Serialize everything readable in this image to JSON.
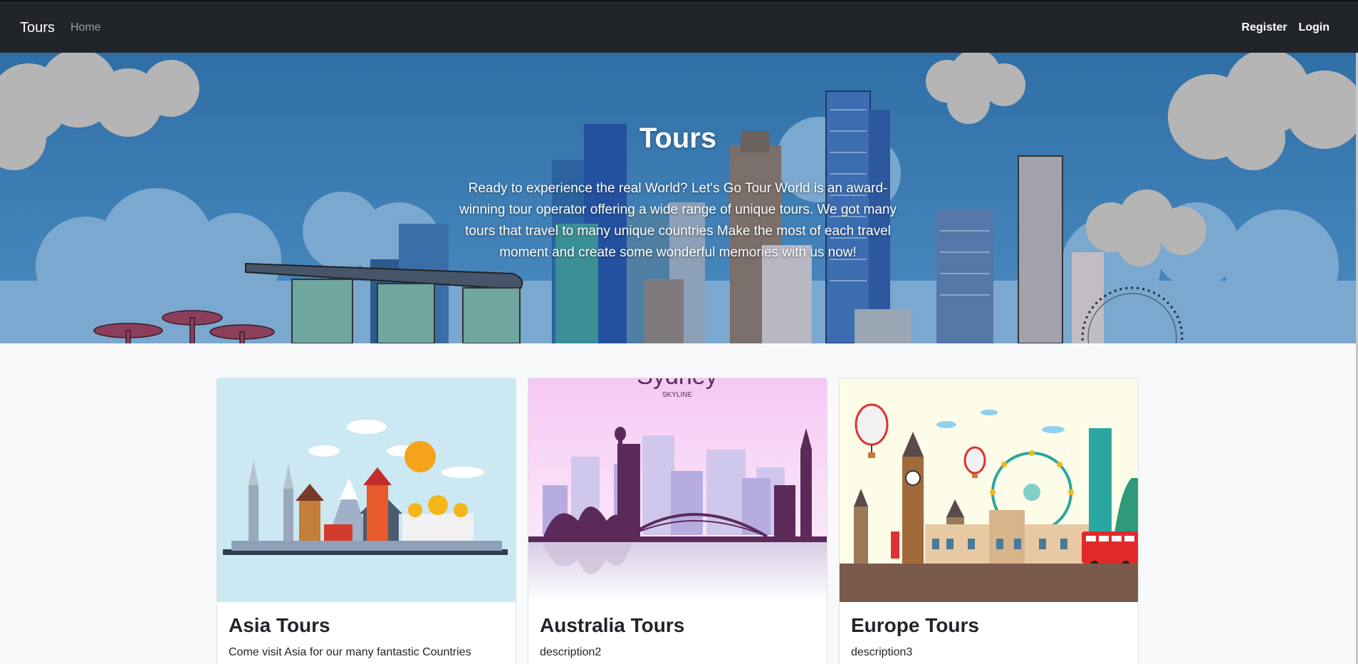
{
  "navbar": {
    "brand": "Tours",
    "home": "Home",
    "register": "Register",
    "login": "Login"
  },
  "hero": {
    "title": "Tours",
    "description": "Ready to experience the real World? Let's Go Tour World is an award-winning tour operator offering a wide range of unique tours. We got many tours that travel to many unique countries Make the most of each travel moment and create some wonderful memories with us now!"
  },
  "cards": [
    {
      "title": "Asia Tours",
      "description": "Come visit Asia for our many fantastic Countries"
    },
    {
      "title": "Australia Tours",
      "description": "description2",
      "image_text": "Sydney",
      "image_subtext": "SKYLINE"
    },
    {
      "title": "Europe Tours",
      "description": "description3"
    }
  ],
  "colors": {
    "navbar_bg": "#212529",
    "hero_sky": "#3a7bb0",
    "page_bg": "#f8f9fa"
  }
}
